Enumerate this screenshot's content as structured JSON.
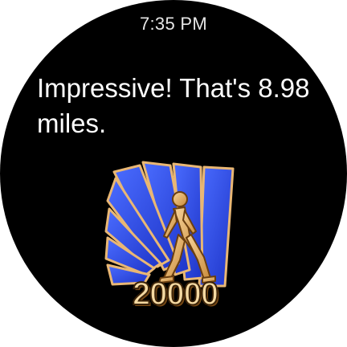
{
  "status_bar": {
    "time": "7:35 PM"
  },
  "notification": {
    "message": "Impressive! That's 8.98 miles."
  },
  "badge": {
    "icon": "walking-person-badge-icon",
    "number": "20000"
  },
  "colors": {
    "background": "#000000",
    "text": "#ffffff",
    "badge_blue": "#2b48e0",
    "badge_gold": "#e8b56a"
  }
}
